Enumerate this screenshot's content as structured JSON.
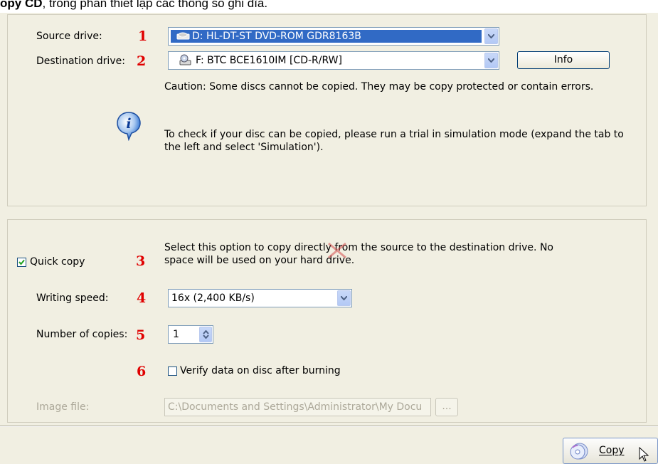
{
  "caption": {
    "bold": "opy CD",
    "rest": ", trong phần thiết lập các thông số ghi đĩa."
  },
  "drives": {
    "source_label": "Source drive:",
    "source_value": "D: HL-DT-ST DVD-ROM GDR8163B",
    "destination_label": "Destination drive:",
    "destination_value": "F: BTC BCE1610IM  [CD-R/RW]",
    "info_button": "Info",
    "caution": "Caution: Some discs cannot be copied. They may be copy protected or contain errors.",
    "check_line1": "To check if your disc can be copied, please run a trial in simulation mode (expand the tab to",
    "check_line2": "the left and select 'Simulation')."
  },
  "markers": [
    "1",
    "2",
    "3",
    "4",
    "5",
    "6"
  ],
  "options": {
    "quick_copy_label": "Quick copy",
    "quick_copy_checked": true,
    "quick_copy_desc1": "Select this option to copy directly from the source to the destination drive. No",
    "quick_copy_desc2": "space will be used on your hard drive.",
    "writing_speed_label": "Writing speed:",
    "writing_speed_value": "16x (2,400 KB/s)",
    "copies_label": "Number of copies:",
    "copies_value": "1",
    "verify_label": "Verify data on disc after burning",
    "verify_checked": false,
    "image_file_label": "Image file:",
    "image_file_value": "C:\\Documents and Settings\\Administrator\\My Docu",
    "browse_button": "..."
  },
  "footer": {
    "copy_button": "Copy"
  },
  "colors": {
    "marker": "#e00000",
    "selection": "#316ac5",
    "dialog_bg": "#f1efe2"
  }
}
